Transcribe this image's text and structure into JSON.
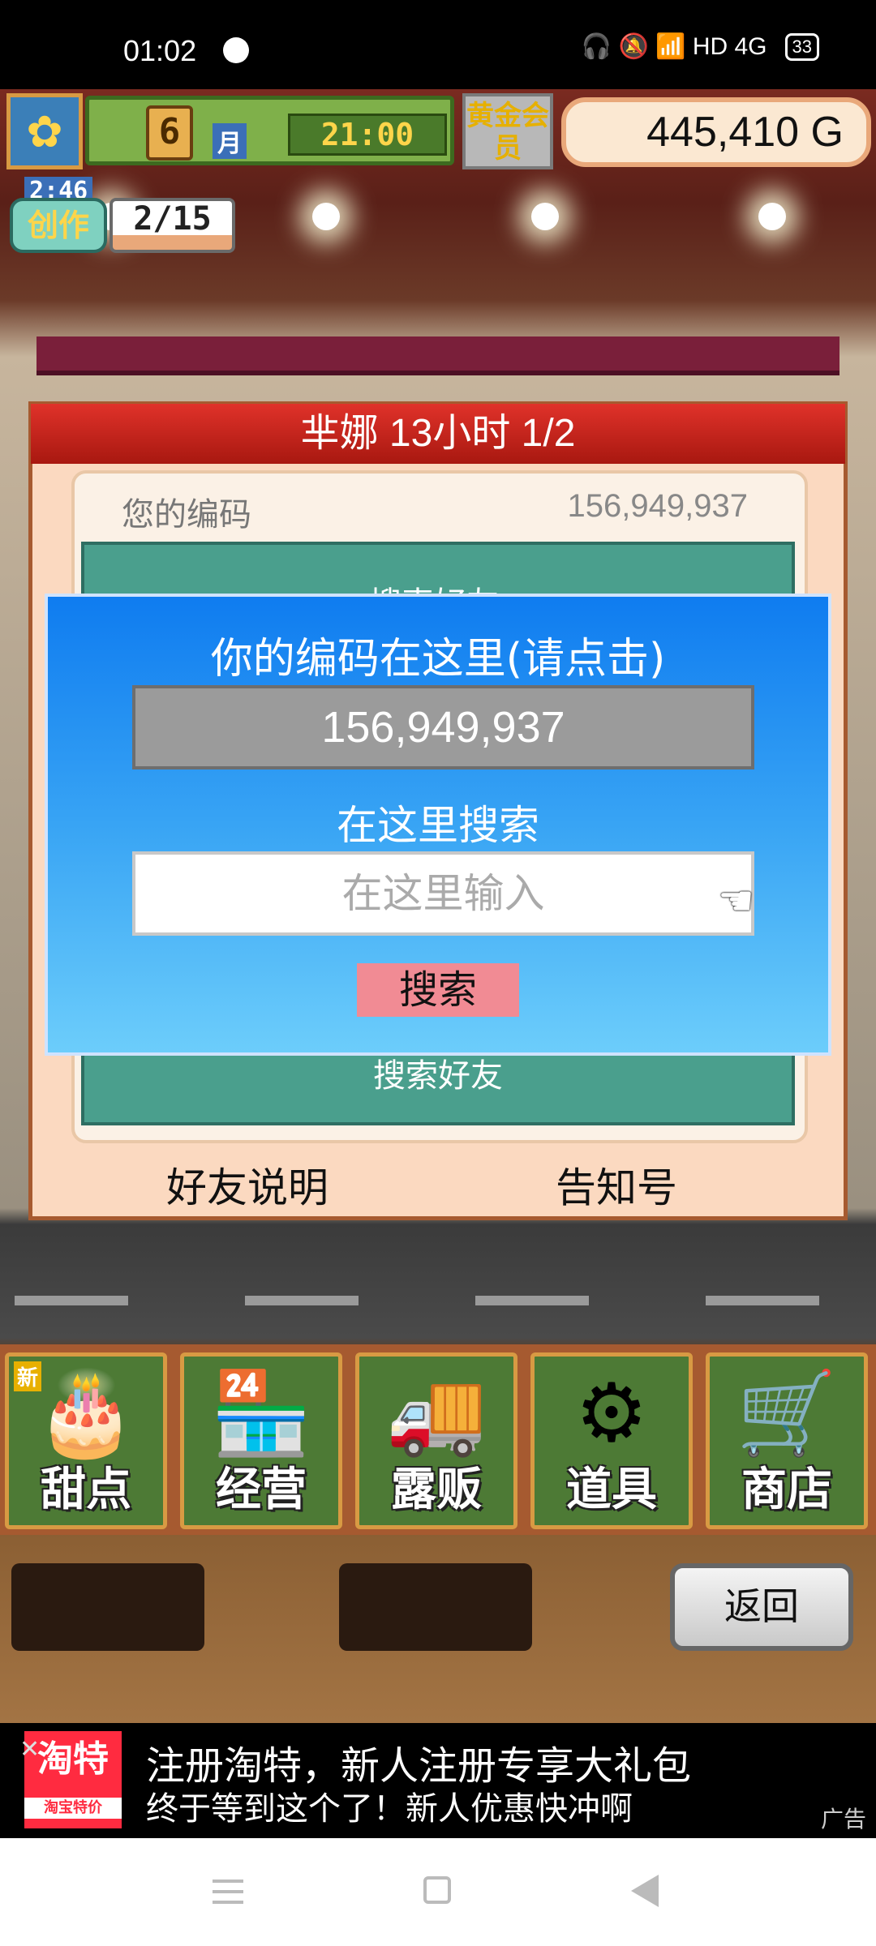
{
  "status_bar": {
    "time": "01:02",
    "icons_right": "🎧 🔕 📶 HD 4G",
    "battery": "33"
  },
  "hud": {
    "month": "6",
    "month_unit": "月",
    "clock": "21:00",
    "gold_member": "黄金会员",
    "money": "445,410 G",
    "timer": "2:46",
    "create_label": "创作",
    "create_count": "2/15"
  },
  "panel": {
    "title": "芈娜  13小时 1/2",
    "my_code_label": "您的编码",
    "my_code_value": "156,949,937",
    "teal_top_text": "搜索好友",
    "teal_bottom_text": "搜索好友",
    "friend_help": "好友说明",
    "notice": "告知号"
  },
  "dialog": {
    "title": "你的编码在这里(请点击)",
    "code": "156,949,937",
    "search_label": "在这里搜索",
    "input_placeholder": "在这里输入",
    "search_button": "搜索"
  },
  "menu": {
    "items": [
      {
        "label": "甜点",
        "icon": "cake-icon",
        "badge": "新"
      },
      {
        "label": "经营",
        "icon": "shop-icon"
      },
      {
        "label": "露贩",
        "icon": "food-truck-icon"
      },
      {
        "label": "道具",
        "icon": "gear-bag-icon"
      },
      {
        "label": "商店",
        "icon": "cart-icon"
      }
    ],
    "back_button": "返回"
  },
  "ad": {
    "logo": "淘特",
    "logo_sub": "淘宝特价",
    "title": "注册淘特，新人注册专享大礼包",
    "subtitle": "终于等到这个了！新人优惠快冲啊",
    "tag": "广告"
  }
}
